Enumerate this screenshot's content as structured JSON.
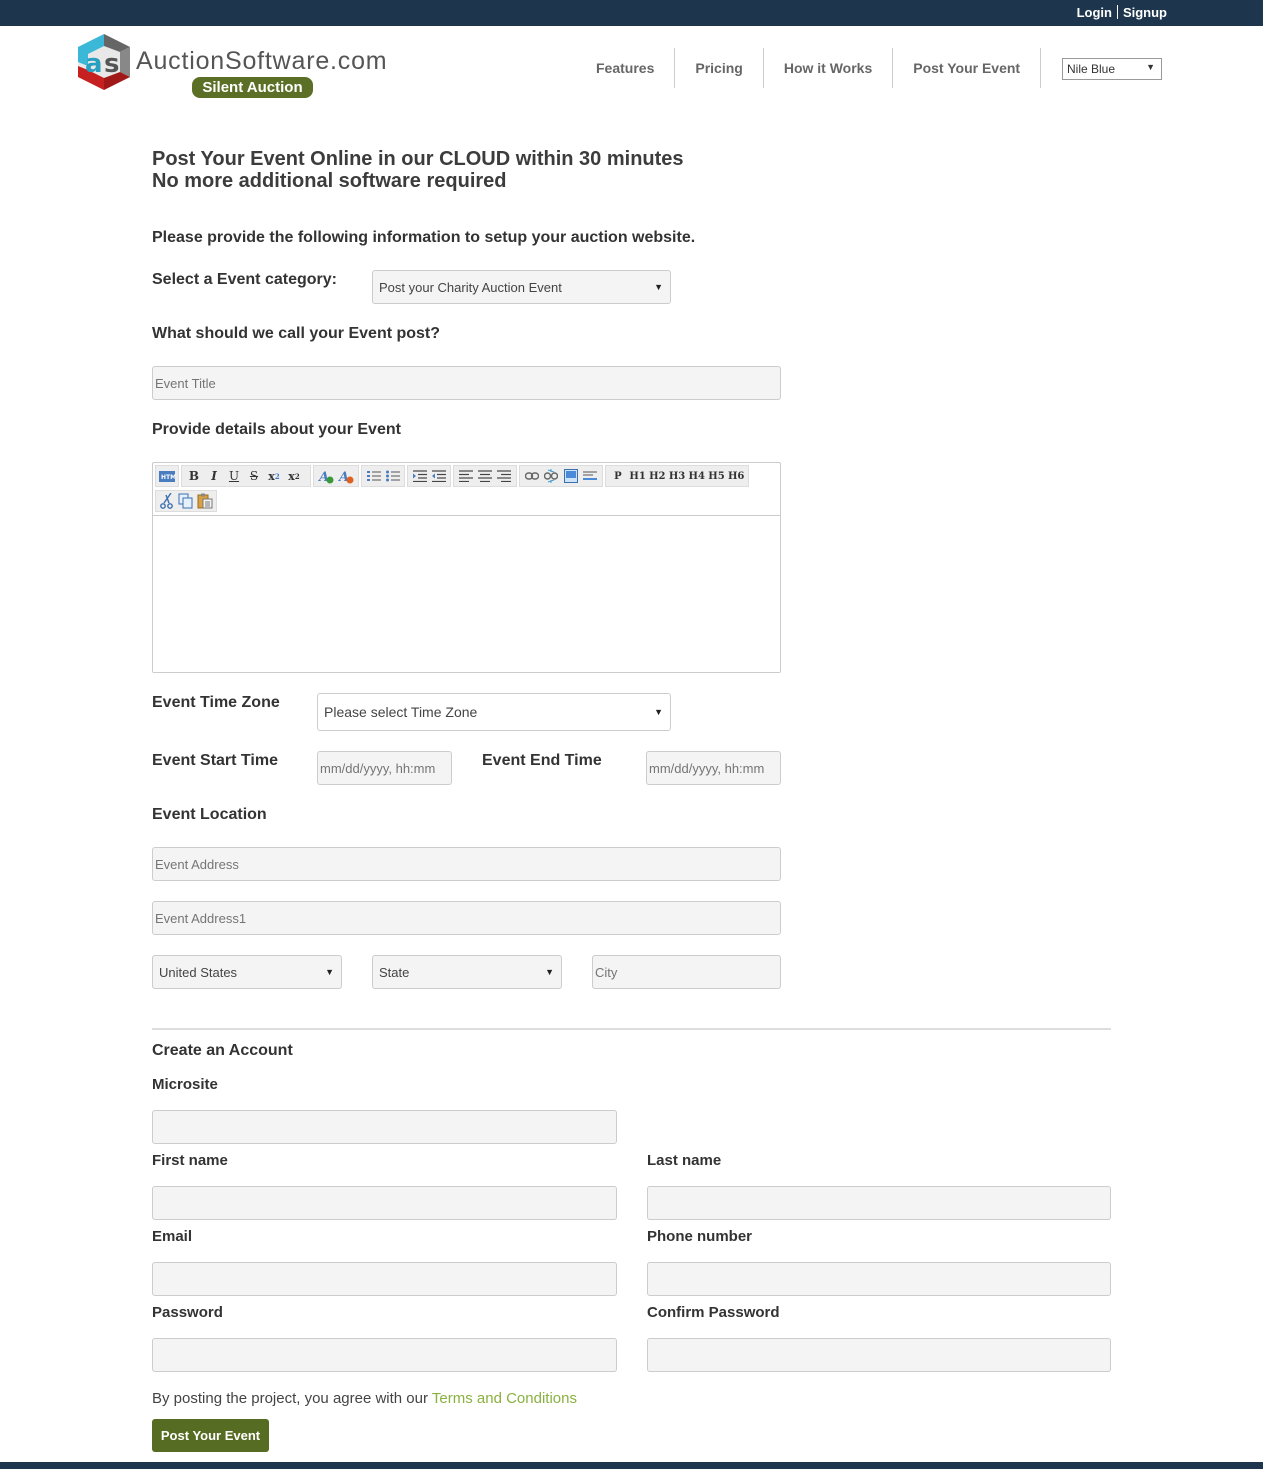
{
  "topbar": {
    "login": "Login",
    "signup": "Signup"
  },
  "logo": {
    "brand": "AuctionSoftware.com",
    "badge": "Silent Auction"
  },
  "nav": {
    "items": [
      "Features",
      "Pricing",
      "How it Works",
      "Post Your Event"
    ],
    "theme_selected": "Nile Blue"
  },
  "heading": {
    "line1": "Post Your Event Online in our CLOUD within 30 minutes",
    "line2": "No more additional software required"
  },
  "form": {
    "intro": "Please provide the following information to setup your auction website.",
    "category_label": "Select a Event category:",
    "category_value": "Post your Charity Auction Event",
    "title_label": "What should we call your Event post?",
    "title_placeholder": "Event Title",
    "details_label": "Provide details about your Event",
    "editor_toolbar": {
      "row1": [
        [
          "html-icon"
        ],
        [
          "B",
          "I",
          "U",
          "S",
          "x₂",
          "x²"
        ],
        [
          "increase-font-icon",
          "decrease-font-icon"
        ],
        [
          "ordered-list-icon",
          "unordered-list-icon"
        ],
        [
          "indent-icon",
          "outdent-icon"
        ],
        [
          "align-left-icon",
          "align-center-icon",
          "align-right-icon"
        ],
        [
          "link-icon",
          "unlink-icon",
          "image-icon",
          "horizontal-rule-icon"
        ],
        [
          "P",
          "H1",
          "H2",
          "H3",
          "H4",
          "H5",
          "H6"
        ]
      ],
      "row2": [
        "cut-icon",
        "copy-icon",
        "paste-icon"
      ]
    },
    "timezone_label": "Event Time Zone",
    "timezone_value": "Please select Time Zone",
    "start_label": "Event Start Time",
    "start_placeholder": "mm/dd/yyyy, hh:mm",
    "end_label": "Event End Time",
    "end_placeholder": "mm/dd/yyyy, hh:mm",
    "location_label": "Event Location",
    "address_placeholder": "Event Address",
    "address1_placeholder": "Event Address1",
    "country_value": "United States",
    "state_value": "State",
    "city_placeholder": "City"
  },
  "account": {
    "heading": "Create an Account",
    "microsite_label": "Microsite",
    "first_name_label": "First name",
    "last_name_label": "Last name",
    "email_label": "Email",
    "phone_label": "Phone number",
    "password_label": "Password",
    "confirm_password_label": "Confirm Password"
  },
  "terms": {
    "text": "By posting the project, you agree with our ",
    "link": "Terms and Conditions"
  },
  "submit_label": "Post Your Event",
  "colors": {
    "topbar": "#1d364d",
    "accent_green": "#566c22",
    "link_green": "#8ab140"
  }
}
